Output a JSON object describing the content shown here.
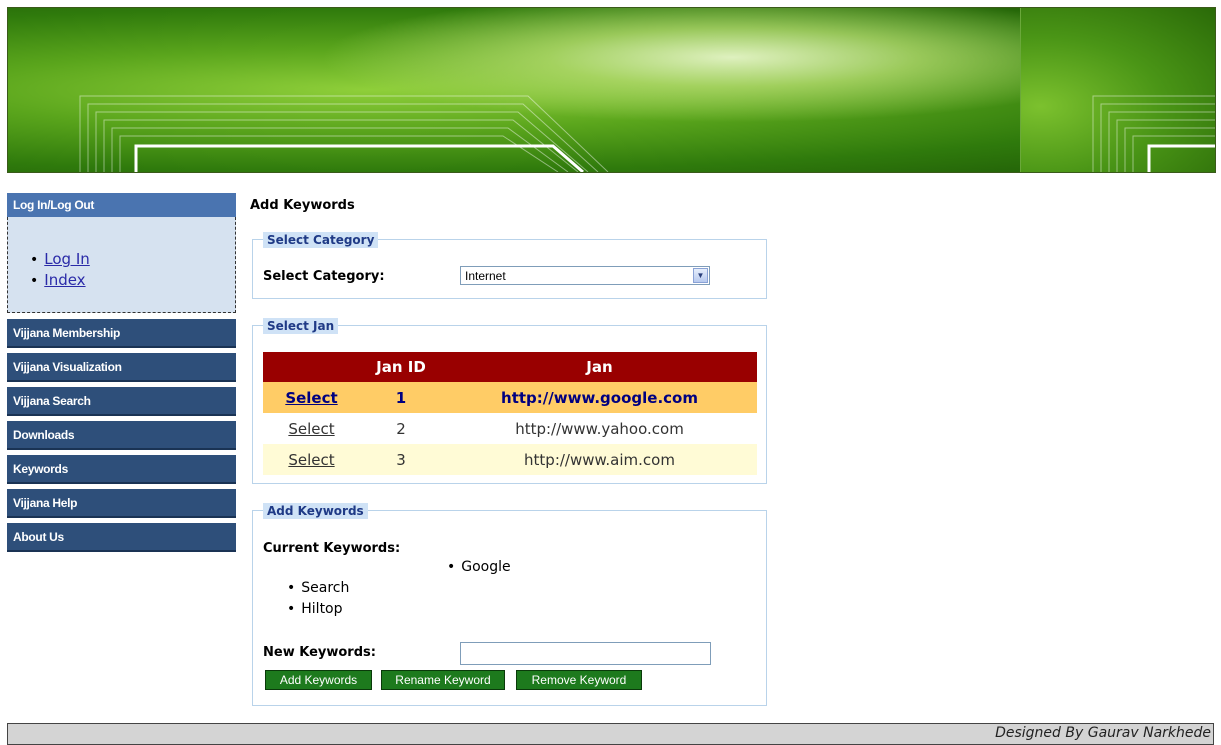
{
  "sidebar": {
    "header": "Log In/Log Out",
    "links": [
      "Log In",
      "Index"
    ],
    "items": [
      "Vijjana Membership",
      "Vijjana Visualization",
      "Vijjana Search",
      "Downloads",
      "Keywords",
      "Vijjana Help",
      "About Us"
    ]
  },
  "main": {
    "title": "Add Keywords",
    "category_section": {
      "legend": "Select Category",
      "label": "Select Category:",
      "selected": "Internet"
    },
    "jan_section": {
      "legend": "Select Jan",
      "columns": [
        "",
        "Jan ID",
        "Jan"
      ],
      "rows": [
        {
          "action": "Select",
          "id": "1",
          "jan": "http://www.google.com"
        },
        {
          "action": "Select",
          "id": "2",
          "jan": "http://www.yahoo.com"
        },
        {
          "action": "Select",
          "id": "3",
          "jan": "http://www.aim.com"
        }
      ]
    },
    "keywords_section": {
      "legend": "Add Keywords",
      "current_label": "Current Keywords:",
      "keywords": [
        "Google",
        "Search",
        "Hiltop"
      ],
      "new_label": "New Keywords:",
      "new_value": "",
      "buttons": {
        "add": "Add Keywords",
        "rename": "Rename Keyword",
        "remove": "Remove Keyword"
      }
    }
  },
  "footer": {
    "credit": "Designed By Gaurav Narkhede"
  },
  "colors": {
    "header_bg": "#990000",
    "selected_row": "#ffcc66",
    "button": "#1d7a1d",
    "nav": "#2e4f7a"
  }
}
